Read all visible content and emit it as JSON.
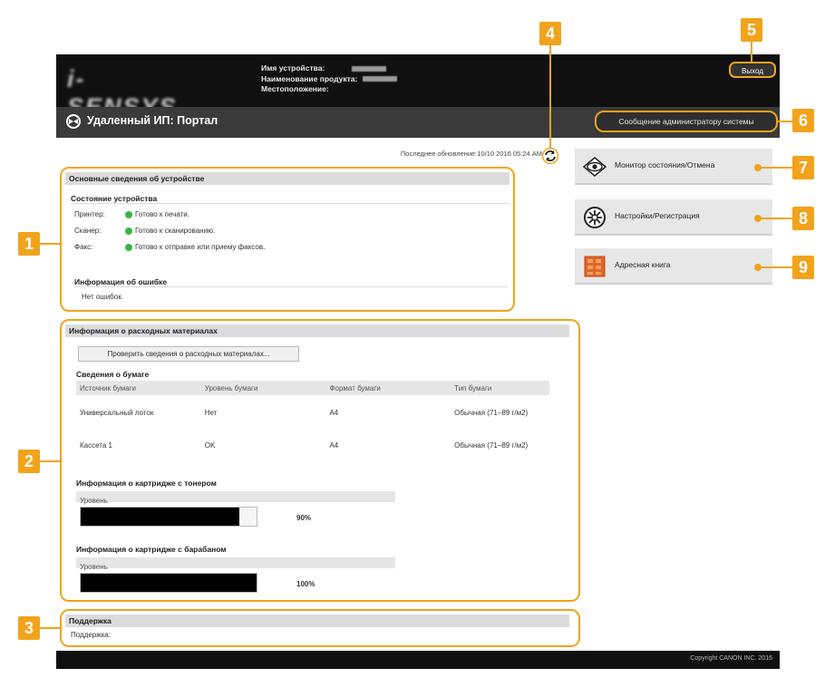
{
  "header": {
    "logo_text": "i-SENSYS",
    "device_name_label": "Имя устройства:",
    "product_name_label": "Наименование продукта:",
    "location_label": "Местоположение:",
    "logout": "Выход"
  },
  "titlebar": {
    "title": "Удаленный ИП: Портал",
    "admin_message": "Сообщение администратору системы"
  },
  "status": {
    "last_update": "Последнее обновление:10/10 2016 05:24 AM"
  },
  "device_info": {
    "heading": "Основные сведения об устройстве",
    "status_heading": "Состояние устройства",
    "rows": [
      {
        "label": "Принтер:",
        "value": "Готово к печати.",
        "color": "#39b54a"
      },
      {
        "label": "Сканер:",
        "value": "Готово к сканированию.",
        "color": "#39b54a"
      },
      {
        "label": "Факс:",
        "value": "Готово к отправке или приему факсов.",
        "color": "#39b54a"
      }
    ],
    "error_heading": "Информация об ошибке",
    "error_text": "Нет ошибок."
  },
  "consumables": {
    "heading": "Информация о расходных материалах",
    "check_button": "Проверить сведения о расходных материалах...",
    "paper_heading": "Сведения о бумаге",
    "paper_columns": [
      "Источник бумаги",
      "Уровень бумаги",
      "Формат бумаги",
      "Тип бумаги"
    ],
    "paper_rows": [
      [
        "Универсальный лоток",
        "Нет",
        "A4",
        "Обычная (71–89 г/м2)"
      ],
      [
        "Кассета 1",
        "OK",
        "A4",
        "Обычная (71–89 г/м2)"
      ]
    ],
    "toner_heading": "Информация о картридже с тонером",
    "toner_level_label": "Уровень",
    "toner_level": 90,
    "toner_percent": "90%",
    "drum_heading": "Информация о картридже с барабаном",
    "drum_level_label": "Уровень",
    "drum_level": 100,
    "drum_percent": "100%"
  },
  "support": {
    "heading": "Поддержка",
    "label": "Поддержка:"
  },
  "menu": {
    "status_monitor": "Монитор состояния/Отмена",
    "settings": "Настройки/Регистрация",
    "address_book": "Адресная книга"
  },
  "callouts": [
    "1",
    "2",
    "3",
    "4",
    "5",
    "6",
    "7",
    "8",
    "9"
  ],
  "footer": {
    "copyright": "Copyright CANON INC. 2016"
  },
  "colors": {
    "accent": "#f2a31b",
    "ok": "#39b54a"
  }
}
